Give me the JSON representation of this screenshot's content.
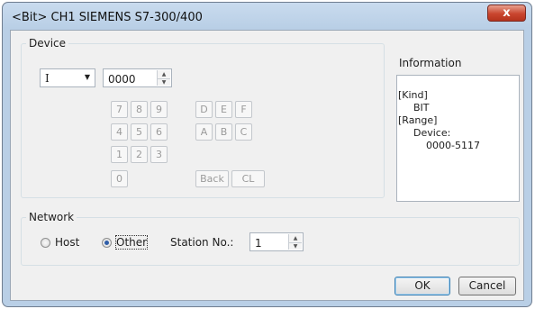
{
  "window": {
    "title": "<Bit> CH1 SIEMENS S7-300/400",
    "close_label": "x"
  },
  "device": {
    "group_label": "Device",
    "type_value": "I",
    "address_value": "0000",
    "keypad": {
      "row1": [
        "7",
        "8",
        "9",
        "D",
        "E",
        "F"
      ],
      "row2": [
        "4",
        "5",
        "6",
        "A",
        "B",
        "C"
      ],
      "row3": [
        "1",
        "2",
        "3"
      ],
      "row4": [
        "0"
      ],
      "back_label": "Back",
      "clear_label": "CL"
    }
  },
  "information": {
    "label": "Information",
    "kind_label": "[Kind]",
    "kind_value": "BIT",
    "range_label": "[Range]",
    "device_label": "Device:",
    "range_value": "0000-5117"
  },
  "network": {
    "group_label": "Network",
    "host_label": "Host",
    "other_label": "Other",
    "selected": "Other",
    "station_label": "Station No.:",
    "station_value": "1"
  },
  "buttons": {
    "ok_label": "OK",
    "cancel_label": "Cancel"
  }
}
